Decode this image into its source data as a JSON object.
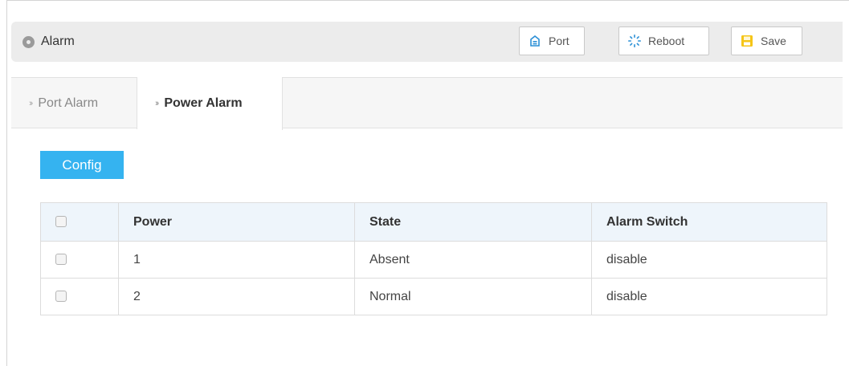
{
  "header": {
    "title": "Alarm",
    "buttons": {
      "port": "Port",
      "reboot": "Reboot",
      "save": "Save"
    }
  },
  "tabs": [
    {
      "label": "Port Alarm",
      "active": false
    },
    {
      "label": "Power Alarm",
      "active": true
    }
  ],
  "config_label": "Config",
  "table": {
    "columns": [
      "Power",
      "State",
      "Alarm Switch"
    ],
    "rows": [
      {
        "power": "1",
        "state": "Absent",
        "alarm_switch": "disable"
      },
      {
        "power": "2",
        "state": "Normal",
        "alarm_switch": "disable"
      }
    ]
  },
  "colors": {
    "accent": "#35b3f0",
    "header_bg": "#ececec",
    "table_header_bg": "#eef5fb"
  }
}
